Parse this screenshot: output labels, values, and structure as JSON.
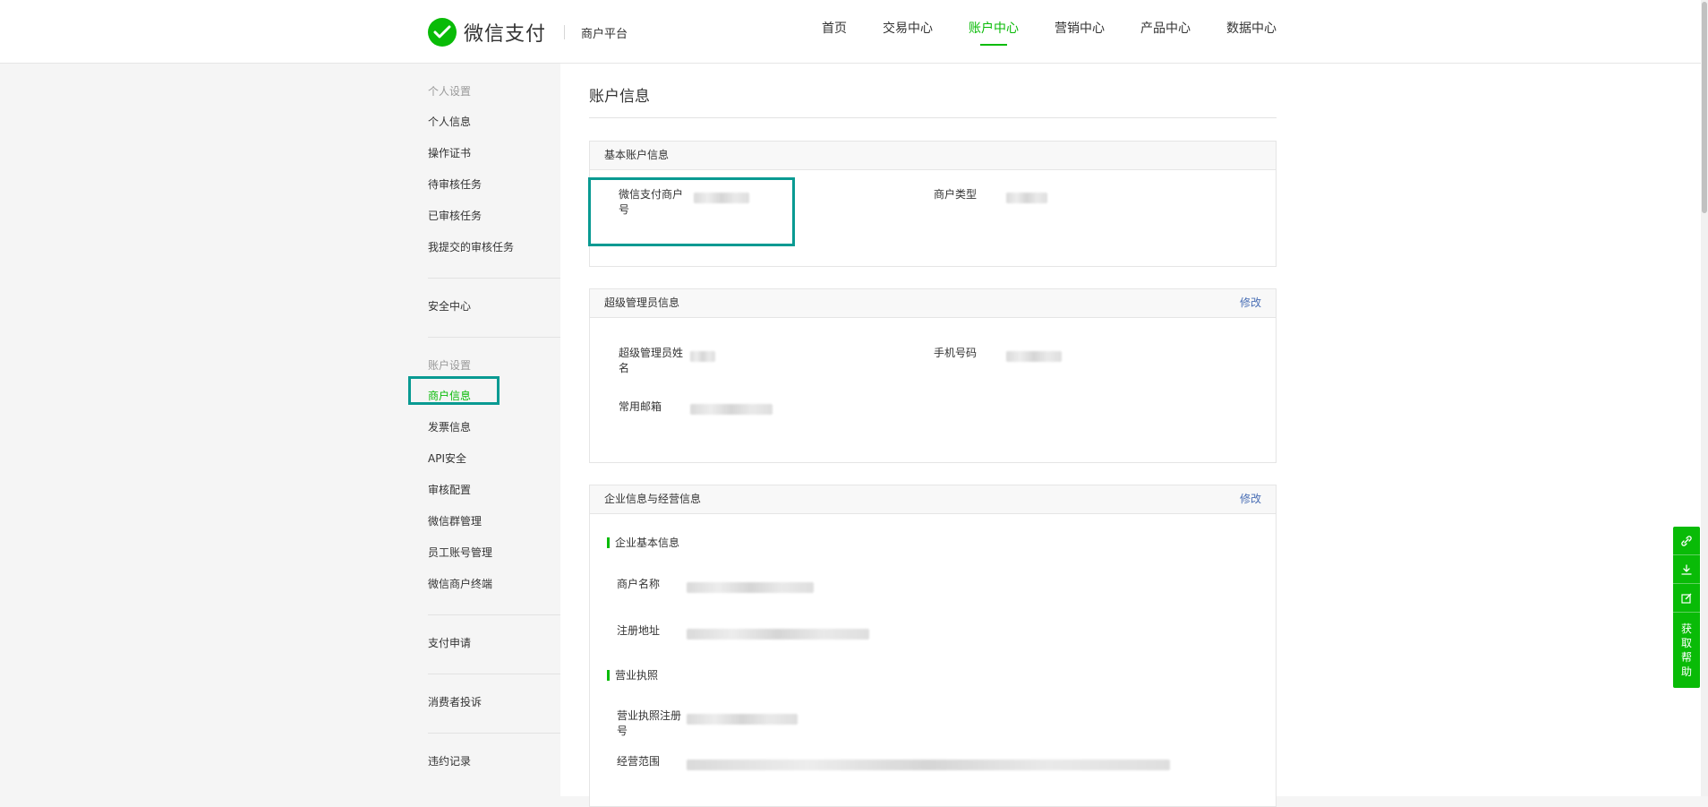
{
  "header": {
    "brand": "微信支付",
    "platform": "商户平台",
    "nav": [
      {
        "label": "首页",
        "active": false
      },
      {
        "label": "交易中心",
        "active": false
      },
      {
        "label": "账户中心",
        "active": true
      },
      {
        "label": "营销中心",
        "active": false
      },
      {
        "label": "产品中心",
        "active": false
      },
      {
        "label": "数据中心",
        "active": false
      }
    ]
  },
  "sidebar": {
    "personal_title": "个人设置",
    "personal_items": [
      "个人信息",
      "操作证书",
      "待审核任务",
      "已审核任务",
      "我提交的审核任务"
    ],
    "security": "安全中心",
    "account_title": "账户设置",
    "account_items": [
      "商户信息",
      "发票信息",
      "API安全",
      "审核配置",
      "微信群管理",
      "员工账号管理",
      "微信商户终端"
    ],
    "pay_apply": "支付申请",
    "complaints": "消费者投诉",
    "violations": "违约记录"
  },
  "main": {
    "title": "账户信息",
    "basic": {
      "title": "基本账户信息",
      "merchant_id_label": "微信支付商户号",
      "merchant_type_label": "商户类型"
    },
    "admin": {
      "title": "超级管理员信息",
      "edit": "修改",
      "name_label": "超级管理员姓名",
      "phone_label": "手机号码",
      "email_label": "常用邮箱"
    },
    "company": {
      "title": "企业信息与经营信息",
      "edit": "修改",
      "basic_title": "企业基本信息",
      "name_label": "商户名称",
      "address_label": "注册地址",
      "license_title": "营业执照",
      "license_no_label": "营业执照注册号",
      "scope_label": "经营范围"
    }
  },
  "float_tools": {
    "help": "获取帮助",
    "icons": [
      "link-icon",
      "download-icon",
      "edit-icon"
    ]
  },
  "colors": {
    "brand_green": "#09bb07",
    "highlight": "#099a92",
    "link_blue": "#4a6fb5"
  }
}
